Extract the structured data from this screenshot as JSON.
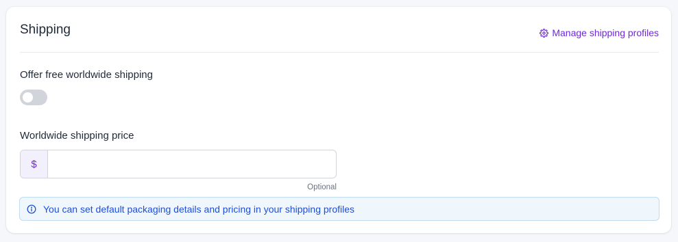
{
  "section": {
    "title": "Shipping",
    "manage_link_label": "Manage shipping profiles",
    "manage_link_icon": "gear-icon"
  },
  "free_shipping": {
    "label": "Offer free worldwide shipping",
    "enabled": false
  },
  "price": {
    "label": "Worldwide shipping price",
    "currency_symbol": "$",
    "value": "",
    "placeholder": "",
    "hint": "Optional"
  },
  "info": {
    "icon": "info-icon",
    "text": "You can set default packaging details and pricing in your shipping profiles"
  },
  "colors": {
    "accent": "#6d28d9",
    "info_text": "#1d4ed8",
    "info_bg": "#eff6fc",
    "toggle_off": "#d1d5db"
  }
}
